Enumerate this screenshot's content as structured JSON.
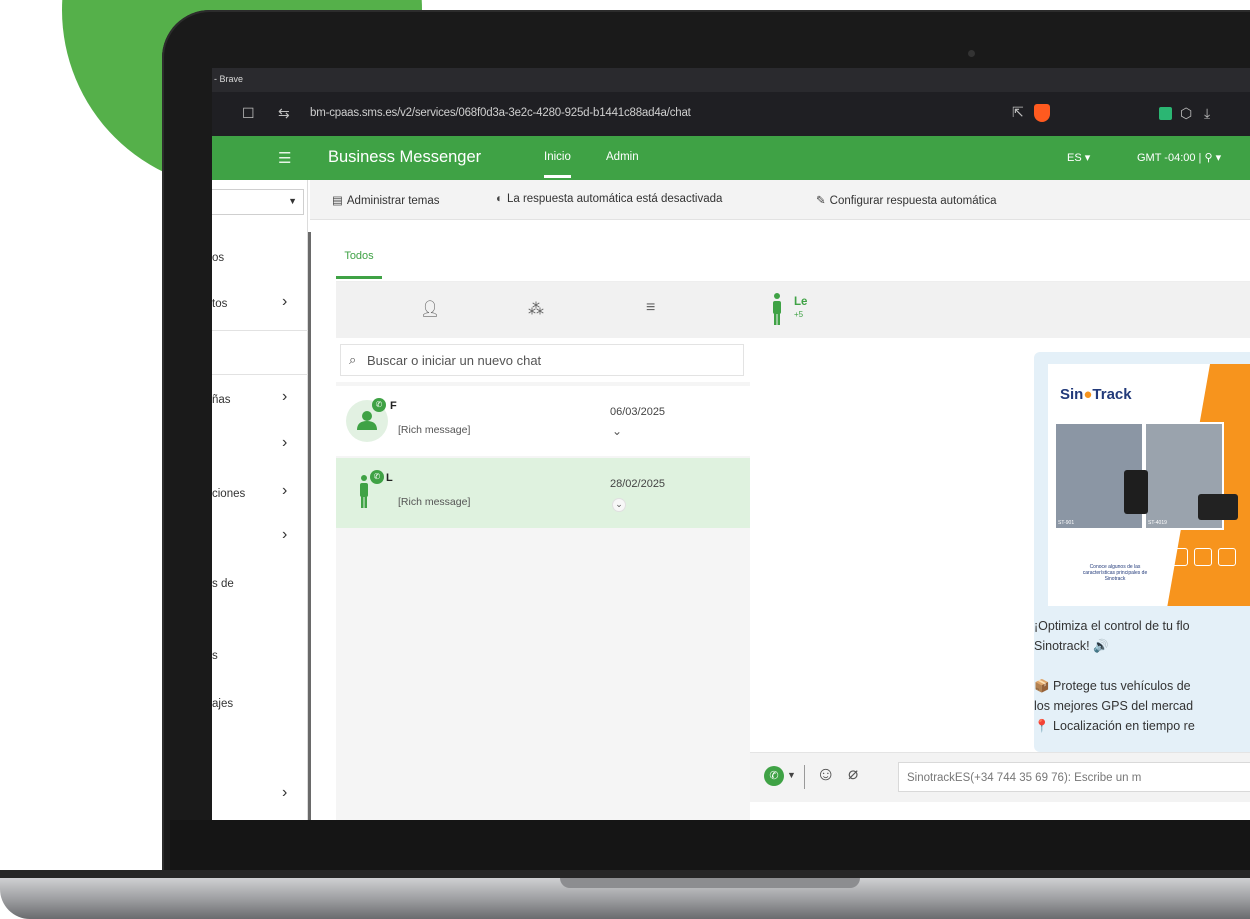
{
  "browser": {
    "window_title": "- Brave",
    "url": "bm-cpaas.sms.es/v2/services/068f0d3a-3e2c-4280-925d-b1441c88ad4a/chat"
  },
  "app": {
    "brand": "Business Messenger",
    "nav": {
      "inicio": "Inicio",
      "admin": "Admin"
    },
    "lang": "ES ▾",
    "timezone": "GMT -04:00 | ⚲ ▾",
    "accent_color": "#3fa245"
  },
  "toolbar": {
    "manage_topics": "Administrar temas",
    "auto_reply_status": "La respuesta automática está desactivada",
    "configure_auto_reply": "Configurar respuesta automática"
  },
  "sidebar": {
    "items": [
      {
        "label": "os"
      },
      {
        "label": "tos"
      },
      {
        "label": "ñas"
      },
      {
        "label": "ciones"
      },
      {
        "label": "s de"
      },
      {
        "label": "s"
      },
      {
        "label": "ajes"
      }
    ]
  },
  "tabs": {
    "todos": "Todos"
  },
  "search": {
    "placeholder": "Buscar o iniciar un nuevo chat"
  },
  "chats": [
    {
      "name": "F",
      "preview": "[Rich message]",
      "date": "06/03/2025",
      "active": false
    },
    {
      "name": "L",
      "preview": "[Rich message]",
      "date": "28/02/2025",
      "active": true
    }
  ],
  "conversation": {
    "contact_name": "Le",
    "contact_number": "+5",
    "promo": {
      "logo_main": "Sin",
      "logo_accent": "Track",
      "caption": "Conoce algunos de las características principales de Sinotrack",
      "device_labels": [
        "ST-901",
        "ST-4019"
      ]
    },
    "message_lines": [
      "¡Optimiza el control de tu flo",
      "Sinotrack! 🔊",
      "",
      "📦 Protege tus vehículos de",
      "los mejores GPS del mercad",
      "📍 Localización en tiempo re"
    ],
    "composer_placeholder": "SinotrackES(+34 744 35 69 76): Escribe un m"
  }
}
